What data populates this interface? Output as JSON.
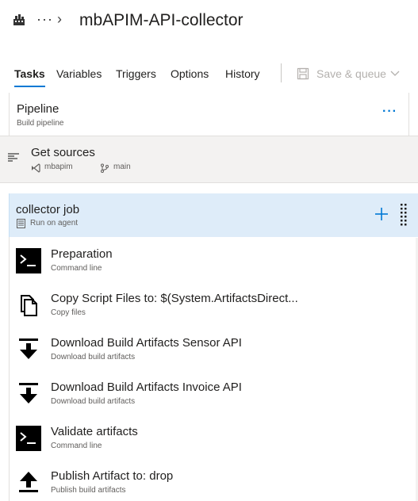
{
  "header": {
    "title": "mbAPIM-API-collector",
    "more_label": "···",
    "chevron": "›",
    "pipeline_icon": "pipelines-icon"
  },
  "tabs": [
    {
      "label": "Tasks",
      "active": true
    },
    {
      "label": "Variables",
      "active": false
    },
    {
      "label": "Triggers",
      "active": false
    },
    {
      "label": "Options",
      "active": false
    },
    {
      "label": "History",
      "active": false
    }
  ],
  "save": {
    "label": "Save & queue",
    "disabled": true
  },
  "pipeline": {
    "title": "Pipeline",
    "subtitle": "Build pipeline",
    "more_label": "···"
  },
  "sources": {
    "title": "Get sources",
    "repo": "mbapim",
    "branch": "main"
  },
  "job": {
    "title": "collector job",
    "subtitle": "Run on agent"
  },
  "task_list": [
    {
      "title": "Preparation",
      "subtitle": "Command line",
      "icon": "command-line-icon"
    },
    {
      "title": "Copy Script Files to: $(System.ArtifactsDirect...",
      "subtitle": "Copy files",
      "icon": "copy-files-icon"
    },
    {
      "title": "Download Build Artifacts Sensor API",
      "subtitle": "Download build artifacts",
      "icon": "download-icon"
    },
    {
      "title": "Download Build Artifacts Invoice API",
      "subtitle": "Download build artifacts",
      "icon": "download-icon"
    },
    {
      "title": "Validate artifacts",
      "subtitle": "Command line",
      "icon": "command-line-icon"
    },
    {
      "title": "Publish Artifact to: drop",
      "subtitle": "Publish build artifacts",
      "icon": "upload-icon"
    }
  ],
  "colors": {
    "accent": "#0078d4",
    "job_bg": "#deecf9",
    "sources_bg": "#f3f2f1"
  }
}
